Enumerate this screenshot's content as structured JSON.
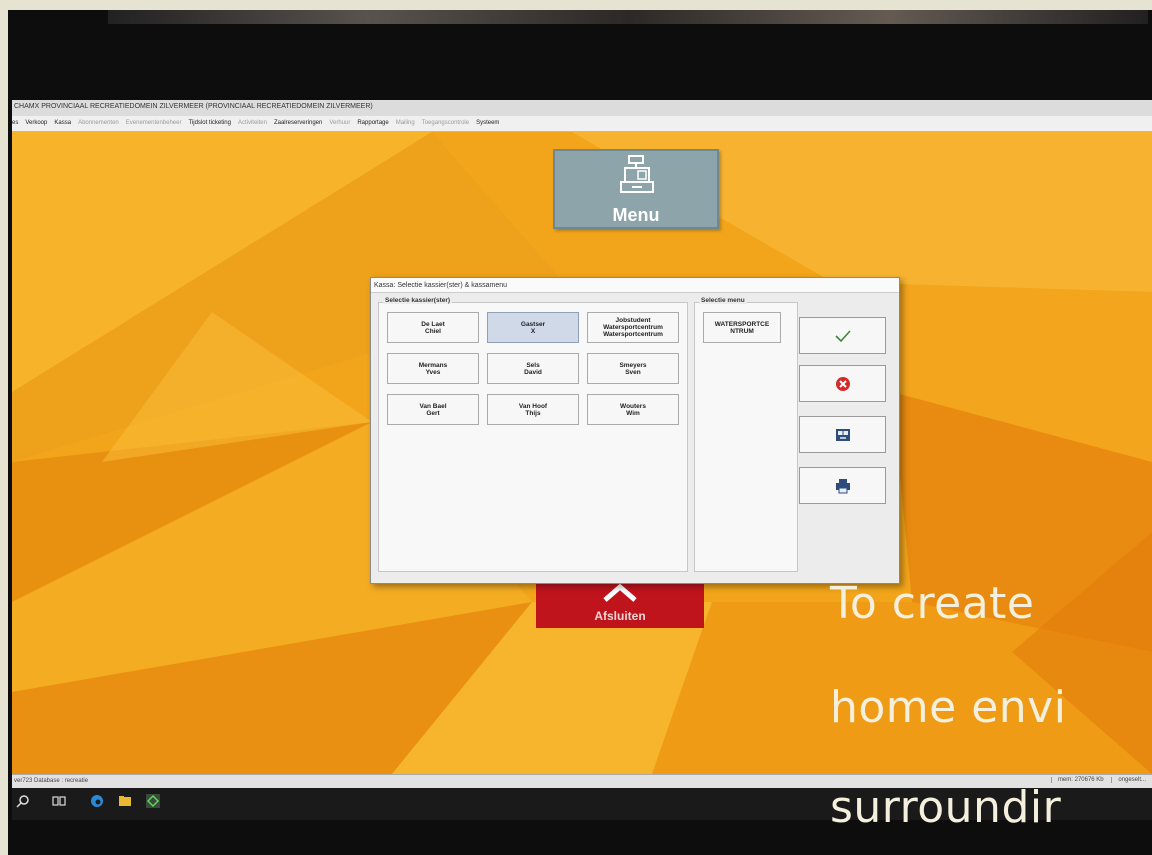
{
  "window": {
    "title": "CHAMX PROVINCIAAL RECREATIEDOMEIN ZILVERMEER (PROVINCIAAL RECREATIEDOMEIN ZILVERMEER)"
  },
  "menubar": {
    "items": [
      {
        "label": "es",
        "enabled": true
      },
      {
        "label": "Verkoop",
        "enabled": true
      },
      {
        "label": "Kassa",
        "enabled": true
      },
      {
        "label": "Abonnementen",
        "enabled": false
      },
      {
        "label": "Evenementenbeheer",
        "enabled": false
      },
      {
        "label": "Tijdslot ticketing",
        "enabled": true
      },
      {
        "label": "Activiteiten",
        "enabled": false
      },
      {
        "label": "Zaalreserveringen",
        "enabled": true
      },
      {
        "label": "Verhuur",
        "enabled": false
      },
      {
        "label": "Rapportage",
        "enabled": true
      },
      {
        "label": "Mailing",
        "enabled": false
      },
      {
        "label": "Toegangscontrole",
        "enabled": false
      },
      {
        "label": "Systeem",
        "enabled": true
      }
    ]
  },
  "menu_tile": {
    "label": "Menu",
    "icon": "cash-register-icon"
  },
  "close_tile": {
    "label": "Afsluiten",
    "icon": "chevron-up-icon"
  },
  "dialog": {
    "title": "Kassa: Selectie kassier(ster) & kassamenu",
    "cashier_group_title": "Selectie kassier(ster)",
    "menu_group_title": "Selectie menu",
    "cashiers": [
      {
        "line1": "De Laet",
        "line2": "Chiel",
        "line3": "",
        "selected": false
      },
      {
        "line1": "Gastser",
        "line2": "X",
        "line3": "",
        "selected": true
      },
      {
        "line1": "Jobstudent",
        "line2": "Watersportcentrum",
        "line3": "Watersportcentrum",
        "selected": false
      },
      {
        "line1": "Mermans",
        "line2": "Yves",
        "line3": "",
        "selected": false
      },
      {
        "line1": "Sels",
        "line2": "David",
        "line3": "",
        "selected": false
      },
      {
        "line1": "Smeyers",
        "line2": "Sven",
        "line3": "",
        "selected": false
      },
      {
        "line1": "Van Bael",
        "line2": "Gert",
        "line3": "",
        "selected": false
      },
      {
        "line1": "Van Hoof",
        "line2": "Thijs",
        "line3": "",
        "selected": false
      },
      {
        "line1": "Wouters",
        "line2": "Wim",
        "line3": "",
        "selected": false
      }
    ],
    "menus": [
      {
        "line1": "WATERSPORTCE",
        "line2": "NTRUM"
      }
    ],
    "actions": [
      {
        "name": "confirm-button",
        "icon": "checkmark-icon"
      },
      {
        "name": "cancel-button",
        "icon": "cancel-icon"
      },
      {
        "name": "cash-drawer-button",
        "icon": "cash-drawer-icon"
      },
      {
        "name": "print-button",
        "icon": "printer-icon"
      }
    ]
  },
  "statusbar": {
    "left": "ver723 Database : recreatie",
    "mem": "mem: 270676 Kb",
    "extra": "ongeselt..."
  },
  "overlay_text": {
    "line1": "To create",
    "line2": "home envi",
    "line3": "surroundir"
  },
  "colors": {
    "wallpaper": "#f2a51a",
    "menu_tile": "#8da4aa",
    "close_tile": "#c0141c",
    "selected_cashier": "#cfd9e8",
    "overlay_text": "#f5f0dd"
  }
}
